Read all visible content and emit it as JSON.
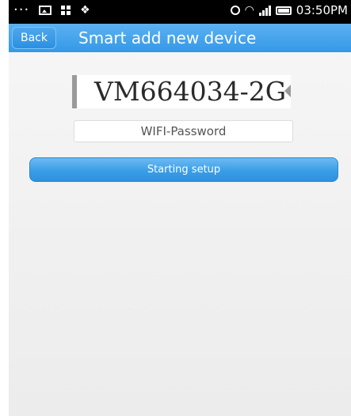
{
  "status_bar": {
    "time": "03:50PM",
    "icons": [
      "more-icon",
      "image-icon",
      "grid-icon",
      "notification-bird-icon",
      "alarm-icon",
      "wifi-icon",
      "signal-icon",
      "battery-icon"
    ]
  },
  "header": {
    "back_label": "Back",
    "title": "Smart add new device"
  },
  "wifi": {
    "ssid": "VM664034-2G",
    "password_placeholder": "WIFI-Password",
    "password_value": ""
  },
  "actions": {
    "setup_label": "Starting setup"
  },
  "colors": {
    "title_bar": "#3498e8",
    "button": "#3a9de6",
    "background": "#f0f0f0"
  }
}
